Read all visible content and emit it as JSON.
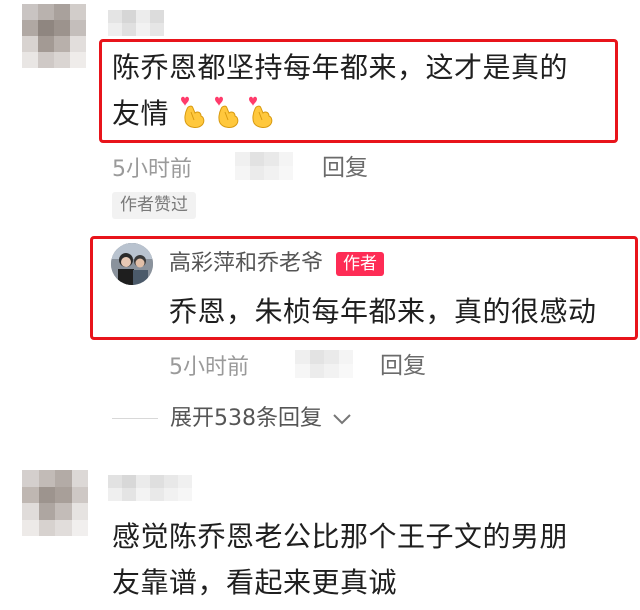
{
  "comments": [
    {
      "text_line1": "陈乔恩都坚持每年都来，这才是真的",
      "text_line2": "友情",
      "emoji_count": 3,
      "time": "5小时前",
      "reply_label": "回复",
      "liked_tag": "作者赞过"
    },
    {
      "text_line1": "感觉陈乔恩老公比那个王子文的男朋",
      "text_line2": "友靠谱，看起来更真诚"
    }
  ],
  "reply": {
    "username": "高彩萍和乔老爷",
    "author_badge": "作者",
    "text": "乔恩，朱桢每年都来，真的很感动",
    "time": "5小时前",
    "reply_label": "回复"
  },
  "expand": {
    "label": "展开538条回复"
  },
  "colors": {
    "highlight_box": "#e8141b",
    "author_badge": "#fe2c55",
    "meta_text": "#9a9a9a"
  }
}
